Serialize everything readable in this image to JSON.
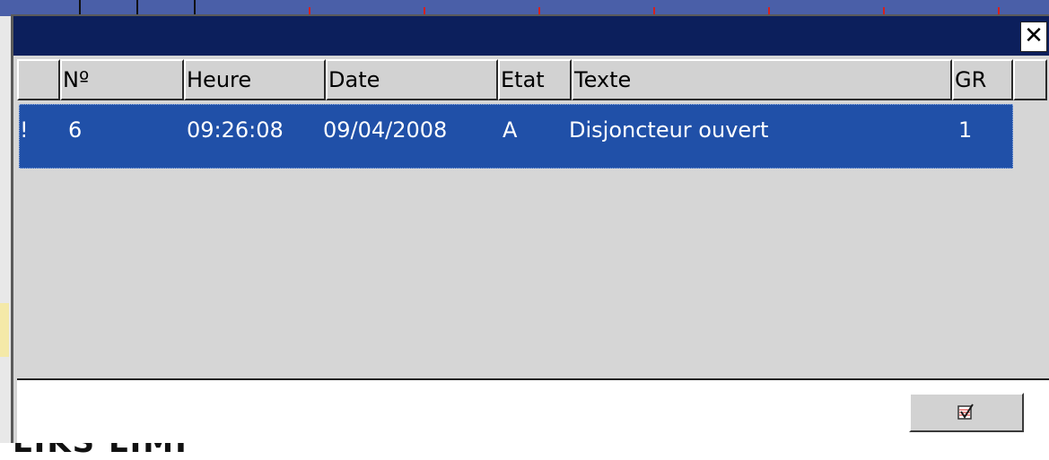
{
  "dialog": {
    "close_glyph": "✕",
    "columns": [
      {
        "key": "flag",
        "label": ""
      },
      {
        "key": "no",
        "label": "Nº"
      },
      {
        "key": "heure",
        "label": "Heure"
      },
      {
        "key": "date",
        "label": "Date"
      },
      {
        "key": "etat",
        "label": "Etat"
      },
      {
        "key": "texte",
        "label": "Texte"
      },
      {
        "key": "gr",
        "label": "GR"
      }
    ],
    "rows": [
      {
        "flag": "!",
        "no": "6",
        "heure": "09:26:08",
        "date": "09/04/2008",
        "etat": "A",
        "texte": "Disjoncteur ouvert",
        "gr": "1"
      }
    ],
    "ack_icon": "acknowledge-checkbox-icon"
  },
  "background": {
    "bottom_text": "LIKS LIMI"
  },
  "colors": {
    "titlebar": "#0c1f5c",
    "selected_row": "#2050a8",
    "panel": "#d6d6d6"
  }
}
